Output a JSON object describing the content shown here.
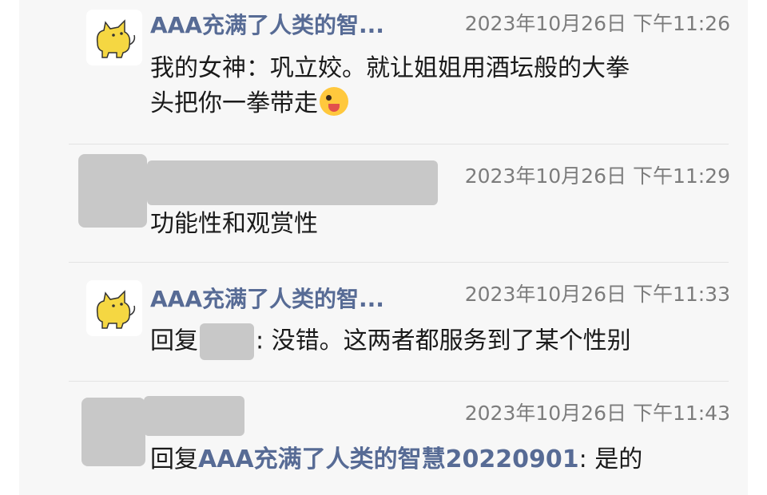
{
  "comments": [
    {
      "author": "AAA充满了人类的智...",
      "time": "2023年10月26日 下午11:26",
      "text_line1": "我的女神：巩立姣。就让姐姐用酒坛般的大拳",
      "text_line2": "头把你一拳带走",
      "emoji": "winking-face-tongue"
    },
    {
      "author": "",
      "time": "2023年10月26日 下午11:29",
      "text": "功能性和观赏性"
    },
    {
      "author": "AAA充满了人类的智...",
      "time": "2023年10月26日 下午11:33",
      "reply_prefix": "回复",
      "text": ": 没错。这两者都服务到了某个性别"
    },
    {
      "author": "",
      "time": "2023年10月26日 下午11:43",
      "reply_prefix": "回复",
      "reply_to": "AAA充满了人类的智慧20220901",
      "text": ": 是的"
    }
  ],
  "colors": {
    "link": "#576b95",
    "timestamp": "#7c7c7c",
    "panel": "#f7f7f7",
    "redaction": "#c8c8c8"
  }
}
